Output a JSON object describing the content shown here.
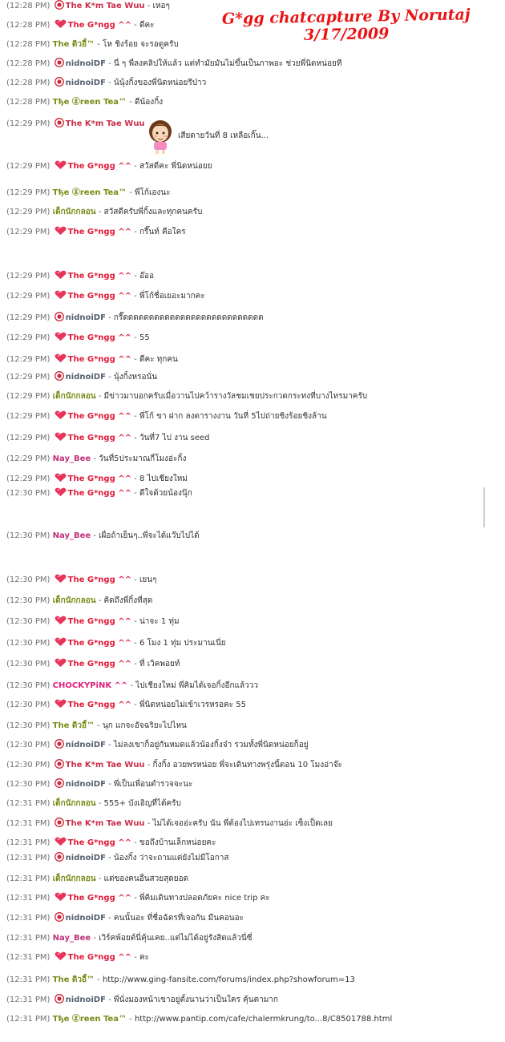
{
  "title": {
    "line1": "G*gg chatcapture By Norutaj",
    "line2": "3/17/2009"
  },
  "colors": {
    "ggg": "#e01c3a",
    "kim": "#c8304a",
    "gold": "#7a8a16",
    "nid": "#556070",
    "nay": "#c0307a",
    "chocky": "#e0207a",
    "time": "#6f6f6f"
  },
  "messages": [
    {
      "time": "(12:28 PM)",
      "icon": "smiley-icon",
      "name": "The K*m Tae Wuu",
      "style": "kim",
      "text": "เหอๆ"
    },
    {
      "time": "(12:28 PM)",
      "icon": "heart-icon",
      "name": "The G*ngg ^^",
      "style": "ggg",
      "text": "ดีคะ"
    },
    {
      "time": "(12:28 PM)",
      "icon": "",
      "name": "The ดิวอี้™",
      "style": "gold",
      "text": "โห ชิงร้อย จะรอดูครับ"
    },
    {
      "time": "(12:28 PM)",
      "icon": "smiley-icon",
      "name": "nidnoiDF",
      "style": "nid",
      "text": "นี่ ๆ พี่ลงคลิปให้แล้ว แต่ทำมัยมันไม่ขึ้นเป็นภาพอะ ช่วยพี่นิดหน่อยที"
    },
    {
      "time": "(12:28 PM)",
      "icon": "smiley-icon",
      "name": "nidnoiDF",
      "style": "nid",
      "text": "น้นุ้งกิ้งของพี่นิดหน่อยรึป่าว"
    },
    {
      "time": "(12:28 PM)",
      "icon": "",
      "name": "Tђe ⓖreen Tea™",
      "style": "gold",
      "text": "ดีน้องกิ้ง"
    },
    {
      "time": "(12:29 PM)",
      "icon": "smiley-icon",
      "name": "The K*m Tae Wuu",
      "style": "kim",
      "text": ""
    },
    {
      "time": "",
      "icon": "",
      "name": "",
      "style": "",
      "text": "เสียดายวันที่ 8 เหลือเกิ๊น..."
    },
    {
      "time": "(12:29 PM)",
      "icon": "heart-icon",
      "name": "The G*ngg ^^",
      "style": "ggg",
      "text": "สวัสดีคะ พี่นิดหน่อยย"
    },
    {
      "time": "(12:29 PM)",
      "icon": "",
      "name": "Tђe ⓖreen Tea™",
      "style": "gold",
      "text": "พี่โก้เองนะ"
    },
    {
      "time": "(12:29 PM)",
      "icon": "",
      "name": "เด็กนักกลอน",
      "style": "gold",
      "text": "สวัสดีครับพี่กิ้งและทุกคนครับ"
    },
    {
      "time": "(12:29 PM)",
      "icon": "heart-icon",
      "name": "The G*ngg ^^",
      "style": "ggg",
      "text": "กรี๊นท์ คือใคร"
    },
    {
      "time": "(12:29 PM)",
      "icon": "heart-icon",
      "name": "The G*ngg ^^",
      "style": "ggg",
      "text": "อ๊ออ"
    },
    {
      "time": "(12:29 PM)",
      "icon": "heart-icon",
      "name": "The G*ngg ^^",
      "style": "ggg",
      "text": "พี่โก้ชื่อเยอะมากคะ"
    },
    {
      "time": "(12:29 PM)",
      "icon": "smiley-icon",
      "name": "nidnoiDF",
      "style": "nid",
      "text": "กรี๊ดดดดดดดดดดดดดดดดดดดดดดดดดดด"
    },
    {
      "time": "(12:29 PM)",
      "icon": "heart-icon",
      "name": "The G*ngg ^^",
      "style": "ggg",
      "text": "55"
    },
    {
      "time": "(12:29 PM)",
      "icon": "heart-icon",
      "name": "The G*ngg ^^",
      "style": "ggg",
      "text": "ดีคะ ทุกคน"
    },
    {
      "time": "(12:29 PM)",
      "icon": "smiley-icon",
      "name": "nidnoiDF",
      "style": "nid",
      "text": "นุ้งกิ้งหรอนั่น"
    },
    {
      "time": "(12:29 PM)",
      "icon": "",
      "name": "เด็กนักกลอน",
      "style": "gold",
      "text": "มีข่าวมาบอกครับเมื่อวานไปคว้ารางวัลชมเชยประกวดกระทงที่บางไทรมาครับ"
    },
    {
      "time": "(12:29 PM)",
      "icon": "heart-icon",
      "name": "The G*ngg ^^",
      "style": "ggg",
      "text": "พี่โก้ ขา ฝาก ลงตารางงาน วันที่ 5ไปถ่ายชิงร้อยชิงล้าน"
    },
    {
      "time": "(12:29 PM)",
      "icon": "heart-icon",
      "name": "The G*ngg ^^",
      "style": "ggg",
      "text": "วันที่7 ไป งาน seed"
    },
    {
      "time": "(12:29 PM)",
      "icon": "",
      "name": "Nay_Bee",
      "style": "nay",
      "text": "วันที่5ประมาณกี่โมงอ่ะกิ้ง"
    },
    {
      "time": "(12:29 PM)",
      "icon": "heart-icon",
      "name": "The G*ngg ^^",
      "style": "ggg",
      "text": "8 ไปเชียงใหม่"
    },
    {
      "time": "(12:30 PM)",
      "icon": "heart-icon",
      "name": "The G*ngg ^^",
      "style": "ggg",
      "text": "ดีใจด้วยน้องนุ๊ก"
    },
    {
      "time": "(12:30 PM)",
      "icon": "",
      "name": "Nay_Bee",
      "style": "nay",
      "text": "เผื่อถ้าเย็นๆ..พี่จะได้แว๊บไปได้"
    },
    {
      "time": "(12:30 PM)",
      "icon": "heart-icon",
      "name": "The G*ngg ^^",
      "style": "ggg",
      "text": "เยนๆ"
    },
    {
      "time": "(12:30 PM)",
      "icon": "",
      "name": "เด็กนักกลอน",
      "style": "gold",
      "text": "คิดถึงพี่กิ้งที่สุด"
    },
    {
      "time": "(12:30 PM)",
      "icon": "heart-icon",
      "name": "The G*ngg ^^",
      "style": "ggg",
      "text": "น่าจะ 1 ทุ่ม"
    },
    {
      "time": "(12:30 PM)",
      "icon": "heart-icon",
      "name": "The G*ngg ^^",
      "style": "ggg",
      "text": "6 โมง 1 ทุ่ม ประมานเนี่ย"
    },
    {
      "time": "(12:30 PM)",
      "icon": "heart-icon",
      "name": "The G*ngg ^^",
      "style": "ggg",
      "text": "ที่ เวิคพอยท์"
    },
    {
      "time": "(12:30 PM)",
      "icon": "",
      "name": "CHOCKYPiNK ^^",
      "style": "chocky",
      "text": "ไปเชียงใหม่ พี่คิมได้เจอกิ้งอีกแล้ววว"
    },
    {
      "time": "(12:30 PM)",
      "icon": "heart-icon",
      "name": "The G*ngg ^^",
      "style": "ggg",
      "text": "พี่นิดหน่อยไม่เข้าเวรหรอคะ 55"
    },
    {
      "time": "(12:30 PM)",
      "icon": "",
      "name": "The ดิวอี้™",
      "style": "gold",
      "text": "นุก แกจะอัจฉริยะไปไหน"
    },
    {
      "time": "(12:30 PM)",
      "icon": "smiley-icon",
      "name": "nidnoiDF",
      "style": "nid",
      "text": "ไม่ลงเขาก็อยู่กันหมดแล้วน้องกิ้งจ๋า รวมทั้งพี่นิดหน่อยก็อยู่"
    },
    {
      "time": "(12:30 PM)",
      "icon": "smiley-icon",
      "name": "The K*m Tae Wuu",
      "style": "kim",
      "text": "กิ้งกิ้ง อวยพรหน่อย พี่จะเดินทางพรุ่งนี้ตอน 10 โมงอ่าจ๊ะ"
    },
    {
      "time": "(12:30 PM)",
      "icon": "smiley-icon",
      "name": "nidnoiDF",
      "style": "nid",
      "text": "พี่เป็นเพื่อนตำรวจจะนะ"
    },
    {
      "time": "(12:31 PM)",
      "icon": "",
      "name": "เด็กนักกลอน",
      "style": "gold",
      "text": "555+ บังเอิญที่ได้ครับ"
    },
    {
      "time": "(12:31 PM)",
      "icon": "smiley-icon",
      "name": "The K*m Tae Wuu",
      "style": "kim",
      "text": "ไม่ได้เจออ่ะครับ นัน พี่ต้องไปเทรนงานอ่ะ เซ็งเป็ดเลย"
    },
    {
      "time": "(12:31 PM)",
      "icon": "heart-icon",
      "name": "The G*ngg ^^",
      "style": "ggg",
      "text": "ขอถึงบ้านเล็กหน่อยคะ"
    },
    {
      "time": "(12:31 PM)",
      "icon": "smiley-icon",
      "name": "nidnoiDF",
      "style": "nid",
      "text": "น้องกิ้ง ว่าจะถามแต่ยังไม่มีโอกาส"
    },
    {
      "time": "(12:31 PM)",
      "icon": "",
      "name": "เด็กนักกลอน",
      "style": "gold",
      "text": "แต่ของคนอื่นสวยสุดยอด"
    },
    {
      "time": "(12:31 PM)",
      "icon": "heart-icon",
      "name": "The G*ngg ^^",
      "style": "ggg",
      "text": "พี่คิมเดินทางปลอดภัยคะ nice trip คะ"
    },
    {
      "time": "(12:31 PM)",
      "icon": "smiley-icon",
      "name": "nidnoiDF",
      "style": "nid",
      "text": "คนนั้นอะ ที่ชื่อฉัตรที่เจอกัน มีนคอนอะ"
    },
    {
      "time": "(12:31 PM)",
      "icon": "",
      "name": "Nay_Bee",
      "style": "nay",
      "text": "เวิร์คพ้อยต์นี่คุ้นเคย..แต่ไม่ได้อยู่รังสิตแล้วนี่ซี่"
    },
    {
      "time": "(12:31 PM)",
      "icon": "heart-icon",
      "name": "The G*ngg ^^",
      "style": "ggg",
      "text": "คะ"
    },
    {
      "time": "(12:31 PM)",
      "icon": "",
      "name": "The ดิวอี้™",
      "style": "gold",
      "text": "http://www.ging-fansite.com/forums/index.php?showforum=13"
    },
    {
      "time": "(12:31 PM)",
      "icon": "smiley-icon",
      "name": "nidnoiDF",
      "style": "nid",
      "text": "พี่นั่งมองหน้าเขาอยู่ตั้งนานว่าเป็นใคร คุ้นตามาก"
    },
    {
      "time": "(12:31 PM)",
      "icon": "",
      "name": "Tђe ⓖreen Tea™",
      "style": "gold",
      "text": "http://www.pantip.com/cafe/chalermkrung/to...8/C8501788.html"
    }
  ]
}
